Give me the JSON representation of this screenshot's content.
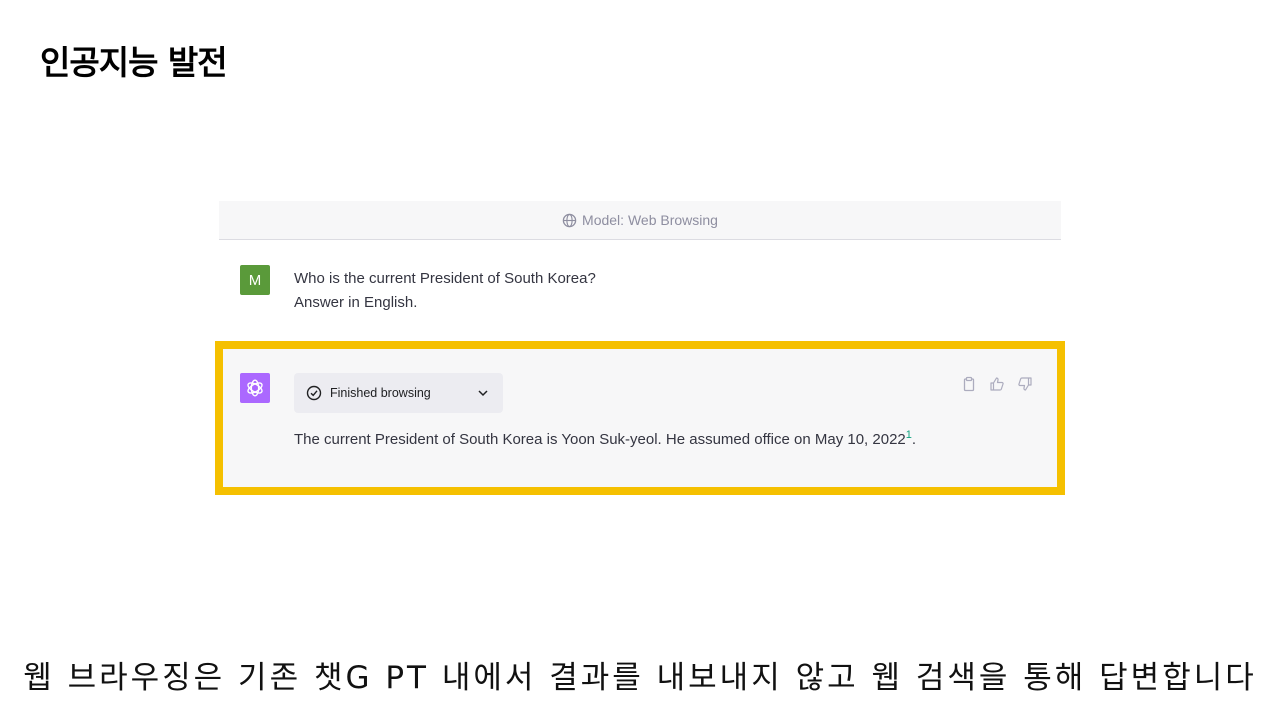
{
  "slide": {
    "title": "인공지능 발전",
    "caption": "웹 브라우징은 기존 챗G PT 내에서 결과를 내보내지 않고 웹 검색을 통해 답변합니다"
  },
  "chat": {
    "model_label": "Model: Web Browsing",
    "user": {
      "avatar_letter": "M",
      "line1": "Who is the current President of South Korea?",
      "line2": "Answer in English."
    },
    "assistant": {
      "browse_label": "Finished browsing",
      "answer": "The current President of South Korea is Yoon Suk-yeol. He assumed office on May 10, 2022",
      "citation": "1",
      "answer_end": "."
    },
    "actions": [
      "clipboard-icon",
      "thumbs-up-icon",
      "thumbs-down-icon"
    ]
  },
  "colors": {
    "highlight_border": "#f5c000",
    "user_avatar": "#5a9a3a",
    "ai_avatar": "#ab68ff",
    "citation": "#10a37f"
  }
}
